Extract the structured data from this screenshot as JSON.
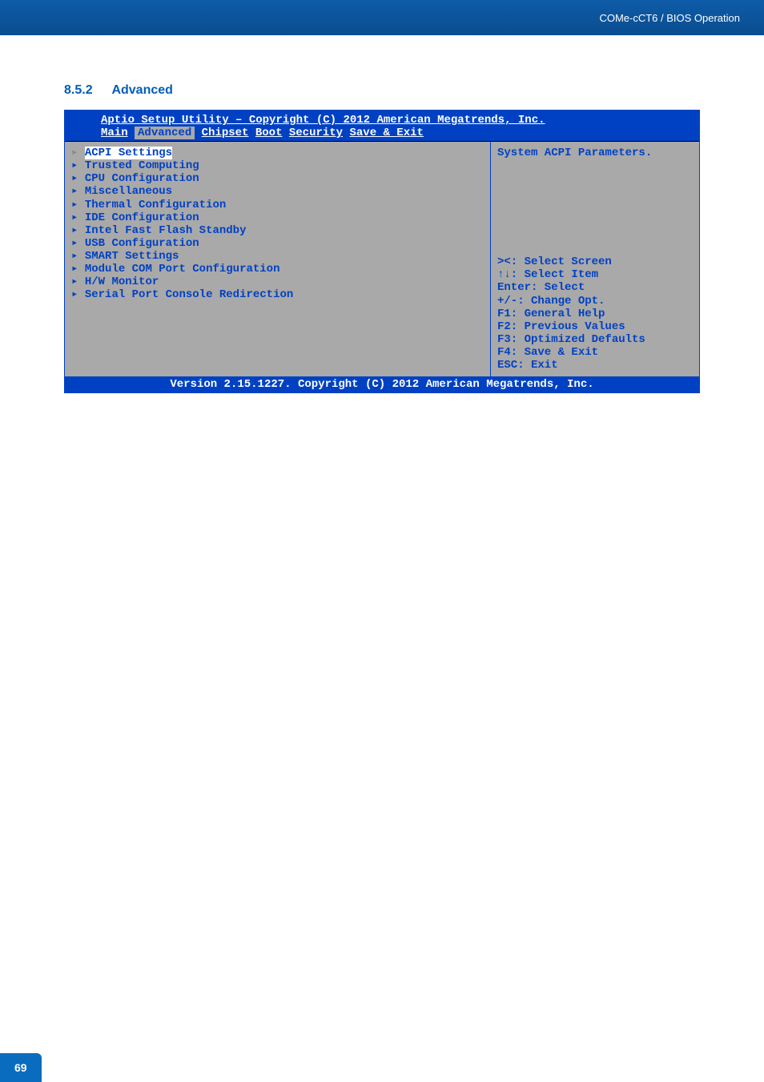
{
  "header": {
    "breadcrumb": "COMe-cCT6 / BIOS Operation"
  },
  "section": {
    "number": "8.5.2",
    "title": "Advanced"
  },
  "bios": {
    "title": "Aptio Setup Utility – Copyright (C) 2012 American Megatrends, Inc.",
    "tabs": {
      "main": "Main",
      "advanced": "Advanced",
      "chipset": "Chipset",
      "boot": "Boot",
      "security": "Security",
      "save_exit": "Save & Exit"
    },
    "menu_items": [
      "ACPI Settings",
      "Trusted Computing",
      "CPU Configuration",
      "Miscellaneous",
      "Thermal Configuration",
      "IDE Configuration",
      "Intel Fast Flash Standby",
      "USB Configuration",
      "SMART Settings",
      "Module COM Port Configuration",
      "H/W Monitor",
      "Serial Port Console Redirection"
    ],
    "help_description": "System ACPI Parameters.",
    "help_keys": [
      "><: Select Screen",
      "↑↓: Select Item",
      "Enter: Select",
      "+/-: Change Opt.",
      "F1: General Help",
      "F2: Previous Values",
      "F3: Optimized Defaults",
      "F4: Save & Exit",
      "ESC: Exit"
    ],
    "footer": "Version 2.15.1227. Copyright (C) 2012 American Megatrends, Inc."
  },
  "page_number": "69"
}
